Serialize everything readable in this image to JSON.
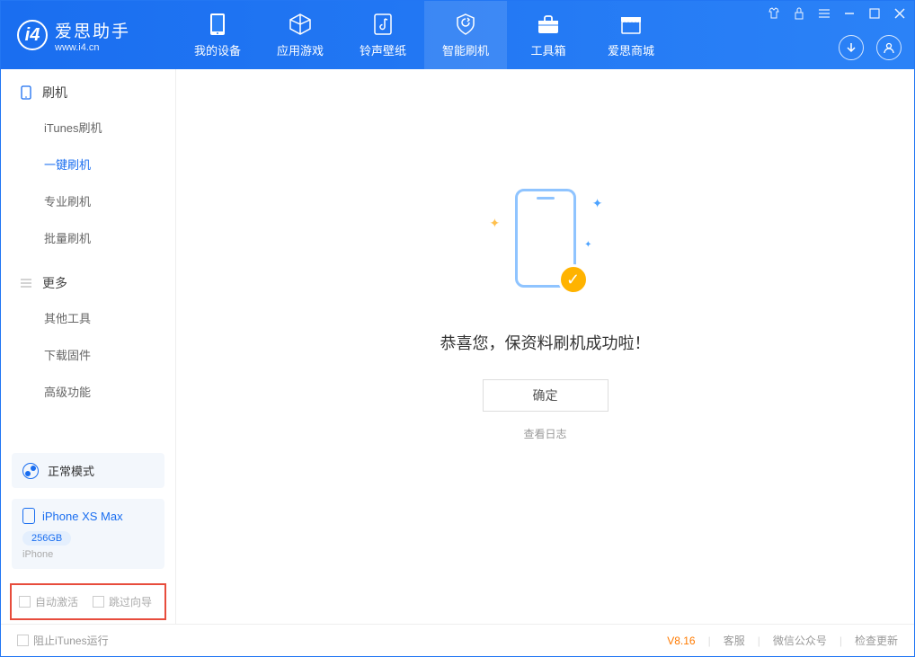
{
  "app": {
    "title": "爱思助手",
    "subtitle": "www.i4.cn"
  },
  "nav": [
    {
      "label": "我的设备"
    },
    {
      "label": "应用游戏"
    },
    {
      "label": "铃声壁纸"
    },
    {
      "label": "智能刷机"
    },
    {
      "label": "工具箱"
    },
    {
      "label": "爱思商城"
    }
  ],
  "sidebar": {
    "section1": {
      "title": "刷机",
      "items": [
        "iTunes刷机",
        "一键刷机",
        "专业刷机",
        "批量刷机"
      ]
    },
    "section2": {
      "title": "更多",
      "items": [
        "其他工具",
        "下载固件",
        "高级功能"
      ]
    }
  },
  "mode": {
    "label": "正常模式"
  },
  "device": {
    "name": "iPhone XS Max",
    "capacity": "256GB",
    "type": "iPhone"
  },
  "checks": {
    "auto_activate": "自动激活",
    "skip_guide": "跳过向导"
  },
  "main": {
    "message": "恭喜您，保资料刷机成功啦！",
    "confirm": "确定",
    "viewlog": "查看日志"
  },
  "footer": {
    "block_itunes": "阻止iTunes运行",
    "version": "V8.16",
    "service": "客服",
    "wechat": "微信公众号",
    "update": "检查更新"
  }
}
